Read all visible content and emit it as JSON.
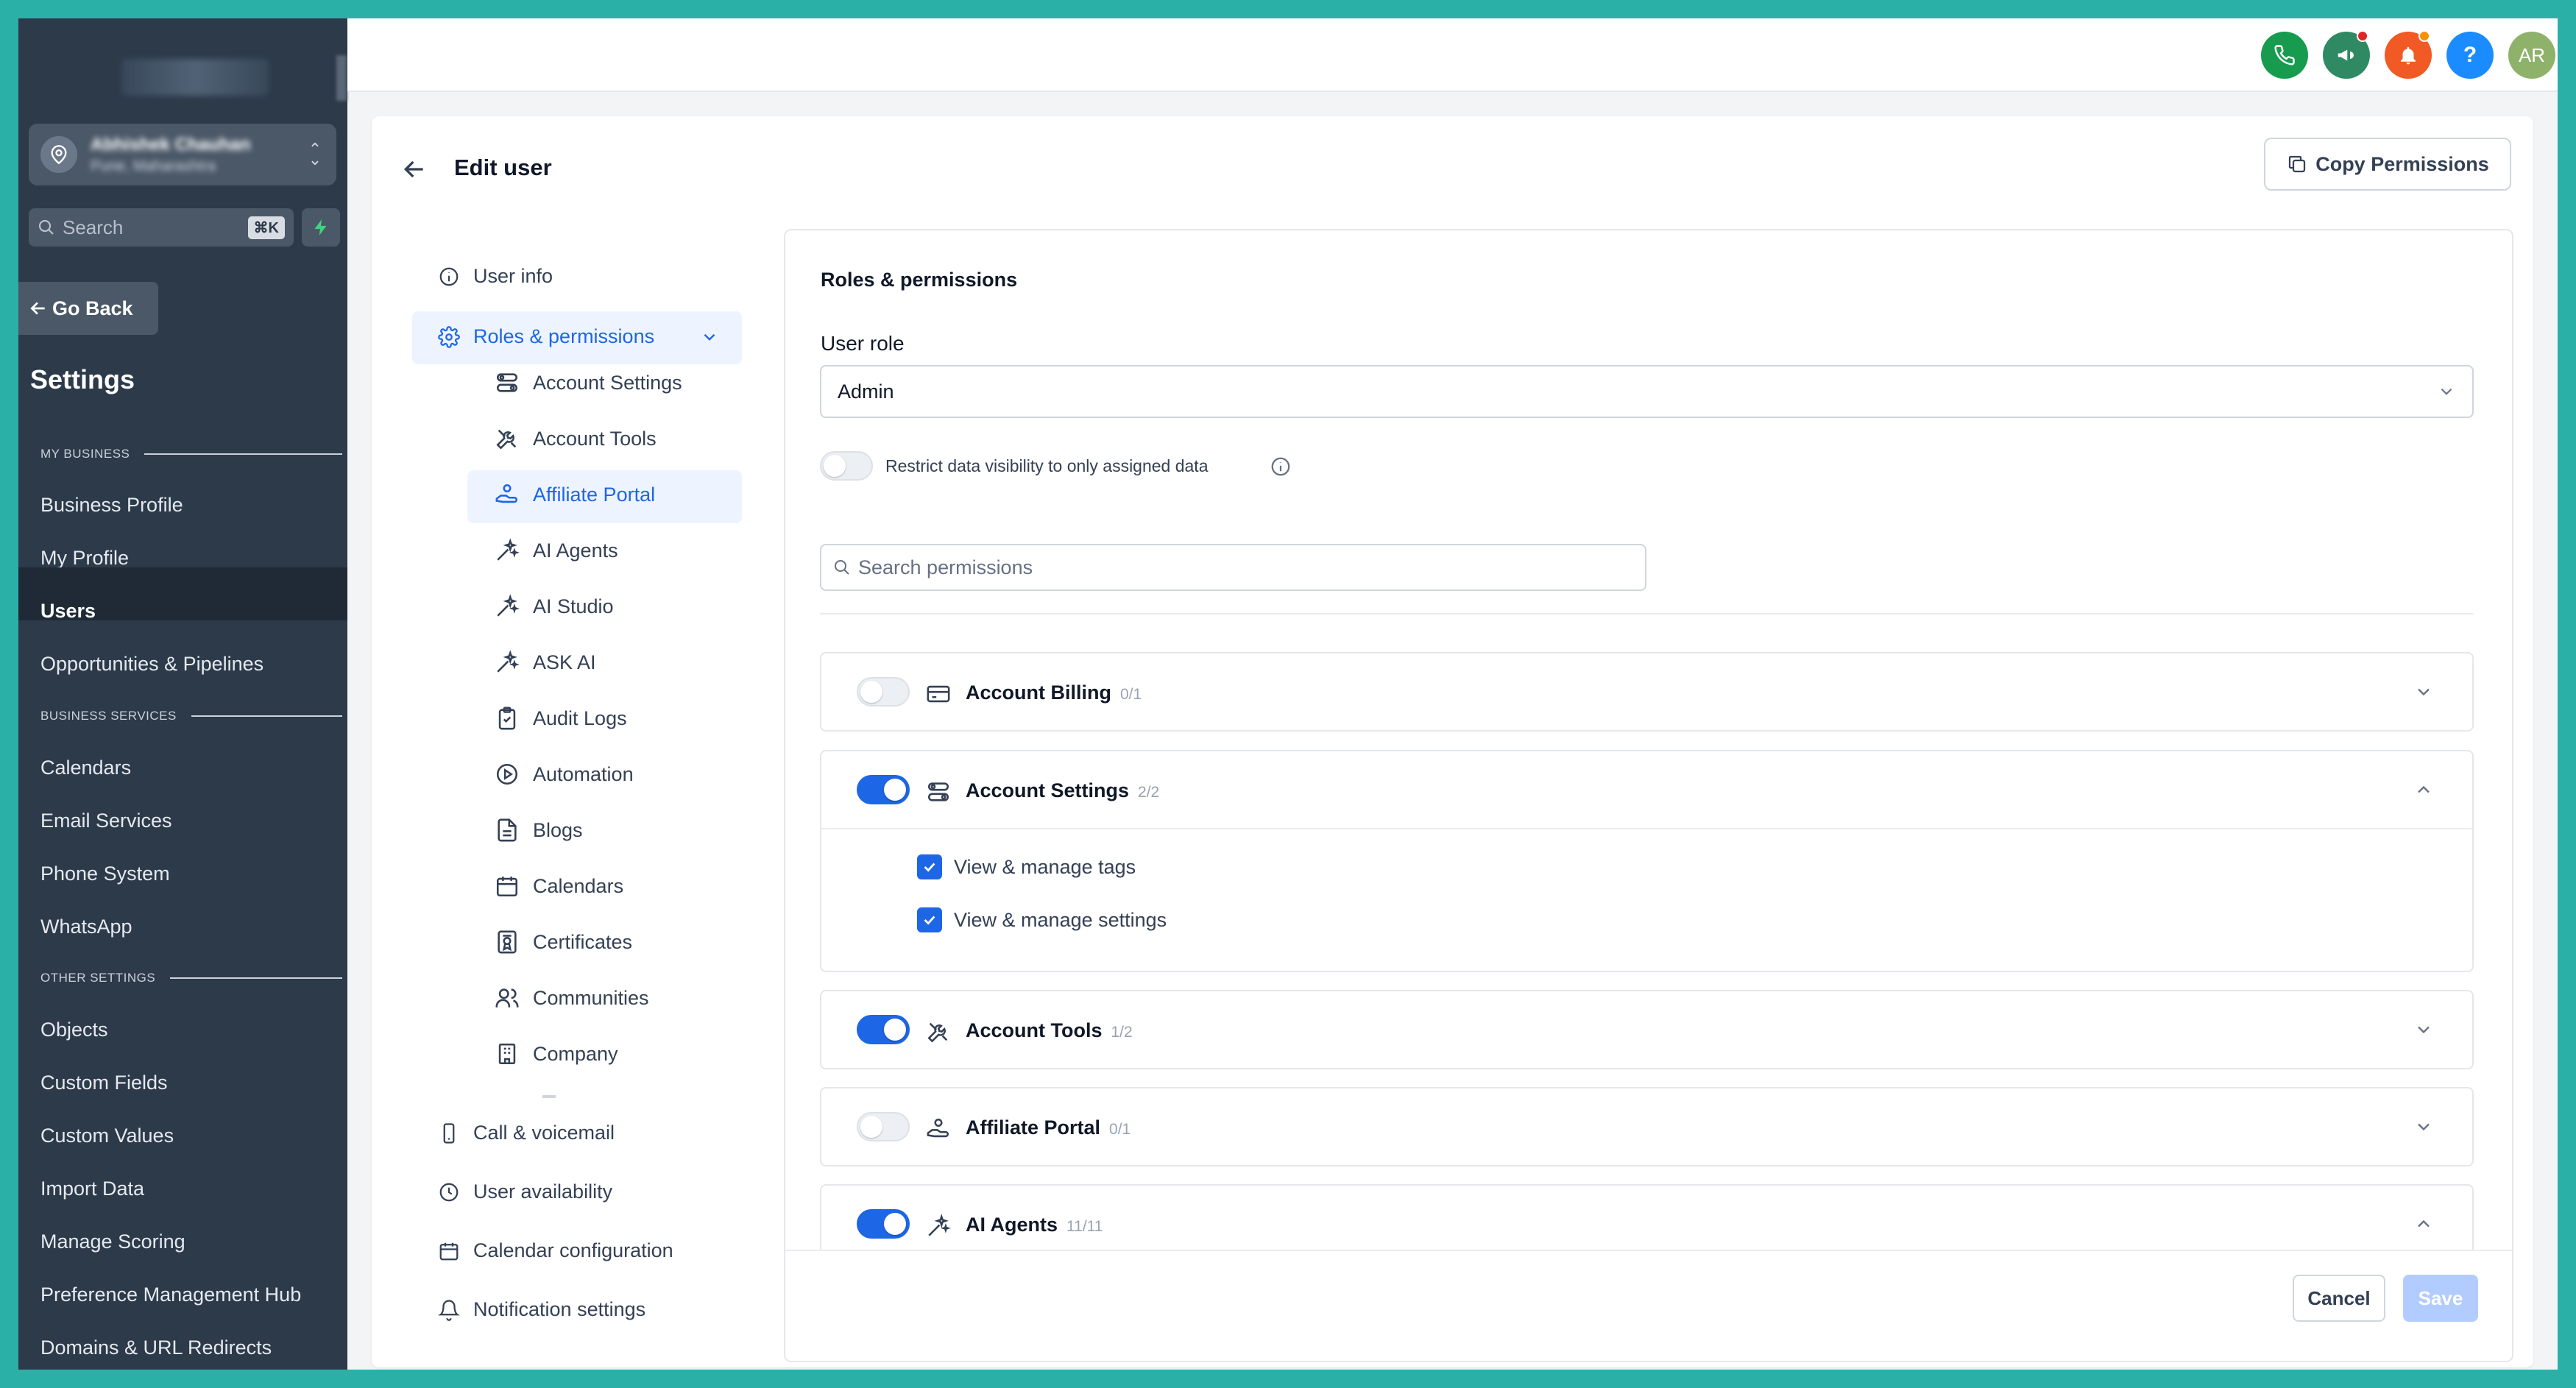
{
  "sidebar": {
    "account_name": "Abhishek Chauhan",
    "account_location": "Pune, Maharashtra",
    "search_placeholder": "Search",
    "search_shortcut": "⌘K",
    "go_back": "Go Back",
    "title": "Settings",
    "sections": {
      "my_business": "MY BUSINESS",
      "business_services": "BUSINESS SERVICES",
      "other_settings": "OTHER SETTINGS"
    },
    "items": [
      {
        "label": "Business Profile"
      },
      {
        "label": "My Profile"
      },
      {
        "label": "Users",
        "active": true
      },
      {
        "label": "Opportunities & Pipelines"
      },
      {
        "label": "Calendars"
      },
      {
        "label": "Email Services"
      },
      {
        "label": "Phone System"
      },
      {
        "label": "WhatsApp"
      },
      {
        "label": "Objects"
      },
      {
        "label": "Custom Fields"
      },
      {
        "label": "Custom Values"
      },
      {
        "label": "Import Data"
      },
      {
        "label": "Manage Scoring"
      },
      {
        "label": "Preference Management Hub"
      },
      {
        "label": "Domains & URL Redirects"
      }
    ]
  },
  "topbar": {
    "avatar_initials": "AR",
    "help_label": "?",
    "colors": {
      "phone": "#169b4f",
      "megaphone": "#2f8a63",
      "bell": "#f15a24",
      "help": "#1a8cff",
      "avatar": "#8fb26b"
    }
  },
  "page": {
    "title": "Edit user",
    "copy_permissions": "Copy Permissions"
  },
  "left_nav": {
    "user_info": "User info",
    "roles_permissions": "Roles & permissions",
    "sub_items": [
      "Account Settings",
      "Account Tools",
      "Affiliate Portal",
      "AI Agents",
      "AI Studio",
      "ASK AI",
      "Audit Logs",
      "Automation",
      "Blogs",
      "Calendars",
      "Certificates",
      "Communities",
      "Company"
    ],
    "active_sub_item": "Affiliate Portal",
    "call_voicemail": "Call & voicemail",
    "user_availability": "User availability",
    "calendar_configuration": "Calendar configuration",
    "notification_settings": "Notification settings"
  },
  "panel": {
    "title": "Roles & permissions",
    "user_role_label": "User role",
    "user_role_value": "Admin",
    "restrict_label": "Restrict data visibility to only assigned data",
    "restrict_enabled": false,
    "search_placeholder": "Search permissions",
    "permissions": [
      {
        "name": "Account Billing",
        "count": "0/1",
        "enabled": false,
        "expanded": false
      },
      {
        "name": "Account Settings",
        "count": "2/2",
        "enabled": true,
        "expanded": true,
        "items": [
          "View & manage tags",
          "View & manage settings"
        ]
      },
      {
        "name": "Account Tools",
        "count": "1/2",
        "enabled": true,
        "expanded": false
      },
      {
        "name": "Affiliate Portal",
        "count": "0/1",
        "enabled": false,
        "expanded": false
      },
      {
        "name": "AI Agents",
        "count": "11/11",
        "enabled": true,
        "expanded": true
      }
    ],
    "cancel": "Cancel",
    "save": "Save"
  },
  "accent_color": "#1d66e5"
}
